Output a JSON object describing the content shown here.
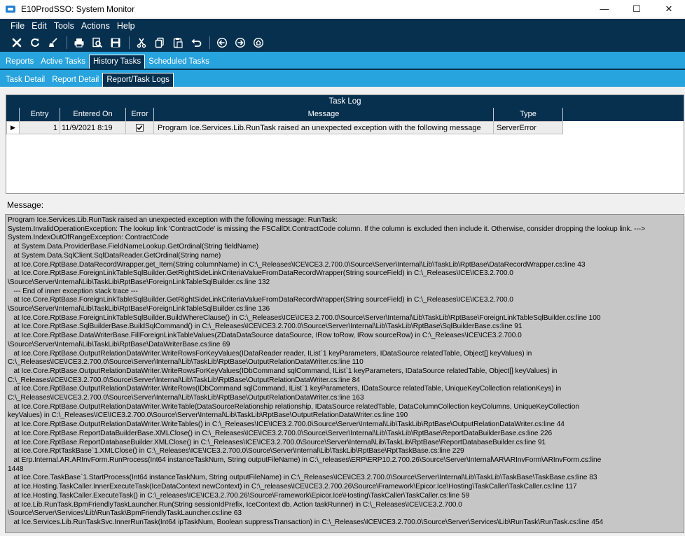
{
  "window": {
    "title": "E10ProdSSO: System Monitor",
    "controls": {
      "minimize": "—",
      "maximize": "☐",
      "close": "✕"
    }
  },
  "menu": {
    "items": [
      "File",
      "Edit",
      "Tools",
      "Actions",
      "Help"
    ]
  },
  "toolbar": {
    "icons": [
      "clear-icon",
      "refresh-icon",
      "sweep-icon",
      "print-icon",
      "print-preview-icon",
      "save-icon",
      "cut-icon",
      "copy-icon",
      "paste-icon",
      "undo-icon",
      "back-icon",
      "forward-icon",
      "home-icon"
    ]
  },
  "tabs_primary": {
    "items": [
      "Reports",
      "Active Tasks",
      "History Tasks",
      "Scheduled Tasks"
    ],
    "active": "History Tasks"
  },
  "tabs_secondary": {
    "items": [
      "Task Detail",
      "Report Detail",
      "Report/Task Logs"
    ],
    "active": "Report/Task Logs"
  },
  "task_log": {
    "title": "Task Log",
    "columns": [
      "Entry",
      "Entered On",
      "Error",
      "Message",
      "Type"
    ],
    "rows": [
      {
        "entry": "1",
        "entered_on": "11/9/2021 8:19",
        "error": true,
        "message": "Program Ice.Services.Lib.RunTask raised an unexpected exception with the following message",
        "type": "ServerError"
      }
    ]
  },
  "message": {
    "label": "Message:",
    "text": "Program Ice.Services.Lib.RunTask raised an unexpected exception with the following message: RunTask:\nSystem.InvalidOperationException: The lookup link 'ContractCode' is missing the FSCallDt.ContractCode column. If the column is excluded then include it. Otherwise, consider dropping the lookup link. ---> System.IndexOutOfRangeException: ContractCode\n   at System.Data.ProviderBase.FieldNameLookup.GetOrdinal(String fieldName)\n   at System.Data.SqlClient.SqlDataReader.GetOrdinal(String name)\n   at Ice.Core.RptBase.DataRecordWrapper.get_Item(String columnName) in C:\\_Releases\\ICE\\ICE3.2.700.0\\Source\\Server\\Internal\\Lib\\TaskLib\\RptBase\\DataRecordWrapper.cs:line 43\n   at Ice.Core.RptBase.ForeignLinkTableSqlBuilder.GetRightSideLinkCriteriaValueFromDataRecordWrapper(String sourceField) in C:\\_Releases\\ICE\\ICE3.2.700.0\n\\Source\\Server\\Internal\\Lib\\TaskLib\\RptBase\\ForeignLinkTableSqlBuilder.cs:line 132\n   --- End of inner exception stack trace ---\n   at Ice.Core.RptBase.ForeignLinkTableSqlBuilder.GetRightSideLinkCriteriaValueFromDataRecordWrapper(String sourceField) in C:\\_Releases\\ICE\\ICE3.2.700.0\n\\Source\\Server\\Internal\\Lib\\TaskLib\\RptBase\\ForeignLinkTableSqlBuilder.cs:line 136\n   at Ice.Core.RptBase.ForeignLinkTableSqlBuilder.BuildWhereClause() in C:\\_Releases\\ICE\\ICE3.2.700.0\\Source\\Server\\Internal\\Lib\\TaskLib\\RptBase\\ForeignLinkTableSqlBuilder.cs:line 100\n   at Ice.Core.RptBase.SqlBuilderBase.BuildSqlCommand() in C:\\_Releases\\ICE\\ICE3.2.700.0\\Source\\Server\\Internal\\Lib\\TaskLib\\RptBase\\SqlBuilderBase.cs:line 91\n   at Ice.Core.RptBase.DataWriterBase.FillForeignLinkTableValues(ZDataDataSource dataSource, IRow toRow, IRow sourceRow) in C:\\_Releases\\ICE\\ICE3.2.700.0\n\\Source\\Server\\Internal\\Lib\\TaskLib\\RptBase\\DataWriterBase.cs:line 69\n   at Ice.Core.RptBase.OutputRelationDataWriter.WriteRowsForKeyValues(IDataReader reader, IList`1 keyParameters, IDataSource relatedTable, Object[] keyValues) in\nC:\\_Releases\\ICE\\ICE3.2.700.0\\Source\\Server\\Internal\\Lib\\TaskLib\\RptBase\\OutputRelationDataWriter.cs:line 110\n   at Ice.Core.RptBase.OutputRelationDataWriter.WriteRowsForKeyValues(IDbCommand sqlCommand, IList`1 keyParameters, IDataSource relatedTable, Object[] keyValues) in\nC:\\_Releases\\ICE\\ICE3.2.700.0\\Source\\Server\\Internal\\Lib\\TaskLib\\RptBase\\OutputRelationDataWriter.cs:line 84\n   at Ice.Core.RptBase.OutputRelationDataWriter.WriteRows(IDbCommand sqlCommand, IList`1 keyParameters, IDataSource relatedTable, UniqueKeyCollection relationKeys) in\nC:\\_Releases\\ICE\\ICE3.2.700.0\\Source\\Server\\Internal\\Lib\\TaskLib\\RptBase\\OutputRelationDataWriter.cs:line 163\n   at Ice.Core.RptBase.OutputRelationDataWriter.WriteTable(DataSourceRelationship relationship, IDataSource relatedTable, DataColumnCollection keyColumns, UniqueKeyCollection\nkeyValues) in C:\\_Releases\\ICE\\ICE3.2.700.0\\Source\\Server\\Internal\\Lib\\TaskLib\\RptBase\\OutputRelationDataWriter.cs:line 190\n   at Ice.Core.RptBase.OutputRelationDataWriter.WriteTables() in C:\\_Releases\\ICE\\ICE3.2.700.0\\Source\\Server\\Internal\\Lib\\TaskLib\\RptBase\\OutputRelationDataWriter.cs:line 44\n   at Ice.Core.RptBase.ReportDataBuilderBase.XMLClose() in C:\\_Releases\\ICE\\ICE3.2.700.0\\Source\\Server\\Internal\\Lib\\TaskLib\\RptBase\\ReportDataBuilderBase.cs:line 226\n   at Ice.Core.RptBase.ReportDatabaseBuilder.XMLClose() in C:\\_Releases\\ICE\\ICE3.2.700.0\\Source\\Server\\Internal\\Lib\\TaskLib\\RptBase\\ReportDatabaseBuilder.cs:line 91\n   at Ice.Core.RptTaskBase`1.XMLClose() in C:\\_Releases\\ICE\\ICE3.2.700.0\\Source\\Server\\Internal\\Lib\\TaskLib\\RptBase\\RptTaskBase.cs:line 229\n   at Erp.Internal.AR.ARInvForm.RunProcess(Int64 instanceTaskNum, String outputFileName) in C:\\_releases\\ERP\\ERP10.2.700.26\\Source\\Server\\Internal\\AR\\ARInvForm\\ARInvForm.cs:line\n1448\n   at Ice.Core.TaskBase`1.StartProcess(Int64 instanceTaskNum, String outputFileName) in C:\\_Releases\\ICE\\ICE3.2.700.0\\Source\\Server\\Internal\\Lib\\TaskLib\\TaskBase\\TaskBase.cs:line 83\n   at Ice.Hosting.TaskCaller.InnerExecuteTask(IceDataContext newContext) in C:\\_releases\\ICE\\ICE3.2.700.26\\Source\\Framework\\Epicor.Ice\\Hosting\\TaskCaller\\TaskCaller.cs:line 117\n   at Ice.Hosting.TaskCaller.ExecuteTask() in C:\\_releases\\ICE\\ICE3.2.700.26\\Source\\Framework\\Epicor.Ice\\Hosting\\TaskCaller\\TaskCaller.cs:line 59\n   at Ice.Lib.RunTask.BpmFriendlyTaskLauncher.Run(String sessionIdPrefix, IceContext db, Action taskRunner) in C:\\_Releases\\ICE\\ICE3.2.700.0\n\\Source\\Server\\Services\\Lib\\RunTask\\BpmFriendlyTaskLauncher.cs:line 63\n   at Ice.Services.Lib.RunTaskSvc.InnerRunTask(Int64 ipTaskNum, Boolean suppressTransaction) in C:\\_Releases\\ICE\\ICE3.2.700.0\\Source\\Server\\Services\\Lib\\RunTask\\RunTask.cs:line 454"
  },
  "colors": {
    "navy": "#07304f",
    "tab_blue": "#27a3dd",
    "message_bg": "#c6c6c6"
  }
}
